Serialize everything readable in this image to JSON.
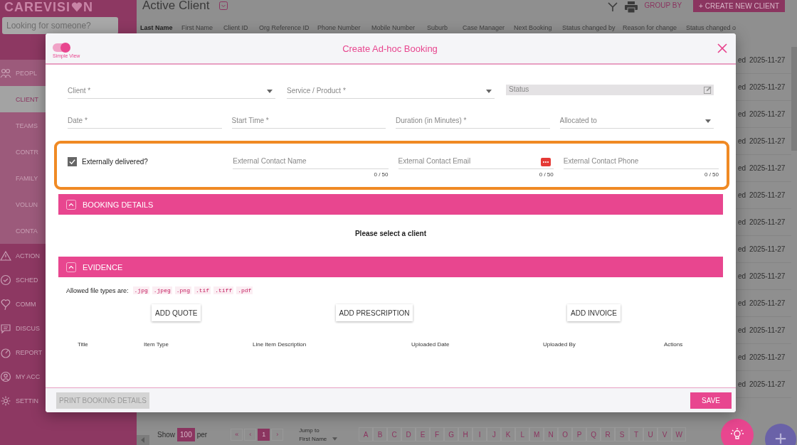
{
  "sidebar": {
    "logo_start": "CAREVISI",
    "logo_end": "N",
    "search": {
      "placeholder": "Looking for someone?"
    },
    "items": [
      {
        "label": "PEOPL",
        "selected": false,
        "children": [
          {
            "label": "CLIENT",
            "selected": true
          },
          {
            "label": "TEAMS",
            "selected": false
          },
          {
            "label": "CONTR",
            "selected": false
          },
          {
            "label": "FAMILY",
            "selected": false
          },
          {
            "label": "VOLUN",
            "selected": false
          },
          {
            "label": "CONTA",
            "selected": false
          }
        ]
      },
      {
        "label": "ACTION",
        "selected": false
      },
      {
        "label": "SCHED",
        "selected": false
      },
      {
        "label": "COMM",
        "selected": false
      },
      {
        "label": "DISCUS",
        "selected": false
      },
      {
        "label": "REPORT",
        "selected": false
      },
      {
        "label": "MY ACC",
        "selected": false
      },
      {
        "label": "SETTIN",
        "selected": false
      }
    ]
  },
  "header": {
    "title": "Active Client",
    "group_by": "GROUP BY",
    "create_button": "+ CREATE NEW CLIENT"
  },
  "table": {
    "columns": [
      {
        "label": "Last Name",
        "sorted": true
      },
      {
        "label": "First Name",
        "sorted": false
      },
      {
        "label": "Client ID",
        "sorted": false
      },
      {
        "label": "Org Reference ID",
        "sorted": false
      },
      {
        "label": "Phone Number",
        "sorted": false
      },
      {
        "label": "Mobile Number",
        "sorted": false
      },
      {
        "label": "Suburb",
        "sorted": false
      },
      {
        "label": "Case Manager",
        "sorted": false
      },
      {
        "label": "Next Booking",
        "sorted": false
      },
      {
        "label": "Status changed by",
        "sorted": false
      },
      {
        "label": "Reason for change",
        "sorted": false
      },
      {
        "label": "Status changed o",
        "sorted": false
      }
    ],
    "rows": [
      {
        "column_11": "ed",
        "column_12": "2025-11-27"
      },
      {
        "column_11": "ed",
        "column_12": "2025-11-27"
      },
      {
        "column_11": "ed",
        "column_12": "2025-11-27"
      },
      {
        "column_11": "ed",
        "column_12": "2025-11-27"
      },
      {
        "column_11": "ed",
        "column_12": "2025-11-27"
      },
      {
        "column_11": "ed",
        "column_12": "2025-11-27"
      },
      {
        "column_11": "ed",
        "column_12": "2025-11-27"
      },
      {
        "column_11": "ed",
        "column_12": "2025-11-27"
      },
      {
        "column_11": "ed",
        "column_12": "2025-11-27"
      },
      {
        "column_11": "ed",
        "column_12": "2025-11-27"
      },
      {
        "column_11": "ed",
        "column_12": "2025-11-27"
      },
      {
        "column_11": "ed",
        "column_12": "2025-11-27"
      },
      {
        "column_11": "ed",
        "column_12": "2025-11-27"
      }
    ]
  },
  "pagination": {
    "show_label": "Show",
    "per_page": "100",
    "per_label": "per",
    "pages": [
      {
        "label": "«",
        "selected": false
      },
      {
        "label": "‹",
        "selected": false
      },
      {
        "label": "1",
        "selected": true
      },
      {
        "label": "›",
        "selected": false
      }
    ],
    "jump_label": "Jump to",
    "jump_value": "First Name",
    "letters": [
      "A",
      "B",
      "C",
      "D",
      "E",
      "F",
      "G",
      "H",
      "I",
      "J",
      "K",
      "L",
      "M",
      "N",
      "O",
      "P",
      "Q",
      "R",
      "S",
      "T",
      "U",
      "V",
      "W"
    ]
  },
  "modal": {
    "simple_view": {
      "label": "Simple View",
      "on": true
    },
    "title": "Create Ad-hoc Booking",
    "field_rows": [
      [
        {
          "placeholder": "Client *",
          "kind": "select"
        },
        {
          "placeholder": "Service / Product *",
          "kind": "select"
        },
        {
          "placeholder": "Status",
          "kind": "readonly"
        }
      ],
      [
        {
          "placeholder": "Date *",
          "kind": "text"
        },
        {
          "placeholder": "Start Time *",
          "kind": "text"
        },
        {
          "placeholder": "Duration (in Minutes) *",
          "kind": "text"
        },
        {
          "placeholder": "Allocated to",
          "kind": "select"
        }
      ]
    ],
    "external": {
      "checkbox": {
        "label": "Externally delivered?",
        "checked": true
      },
      "fields": [
        {
          "placeholder": "External Contact Name",
          "kind": "text",
          "counter": "0 / 50"
        },
        {
          "placeholder": "External Contact Email",
          "kind": "email",
          "counter": "0 / 50"
        },
        {
          "placeholder": "External Contact Phone",
          "kind": "text",
          "counter": "0 / 50"
        }
      ]
    },
    "booking_details": {
      "title": "BOOKING DETAILS",
      "expanded": true,
      "message": "Please select a client"
    },
    "evidence": {
      "title": "EVIDENCE",
      "expanded": true,
      "allowed_label": "Allowed file types are:",
      "file_types": [
        ".jpg",
        ".jpeg",
        ".png",
        ".tif",
        ".tiff",
        ".pdf"
      ],
      "buttons": [
        "ADD QUOTE",
        "ADD PRESCRIPTION",
        "ADD INVOICE"
      ],
      "columns": [
        "Title",
        "Item Type",
        "Line Item Description",
        "Uploaded Date",
        "Uploaded By",
        "Actions"
      ]
    },
    "print_button": {
      "label": "PRINT BOOKING DETAILS",
      "disabled": true
    },
    "save_button": "SAVE"
  }
}
